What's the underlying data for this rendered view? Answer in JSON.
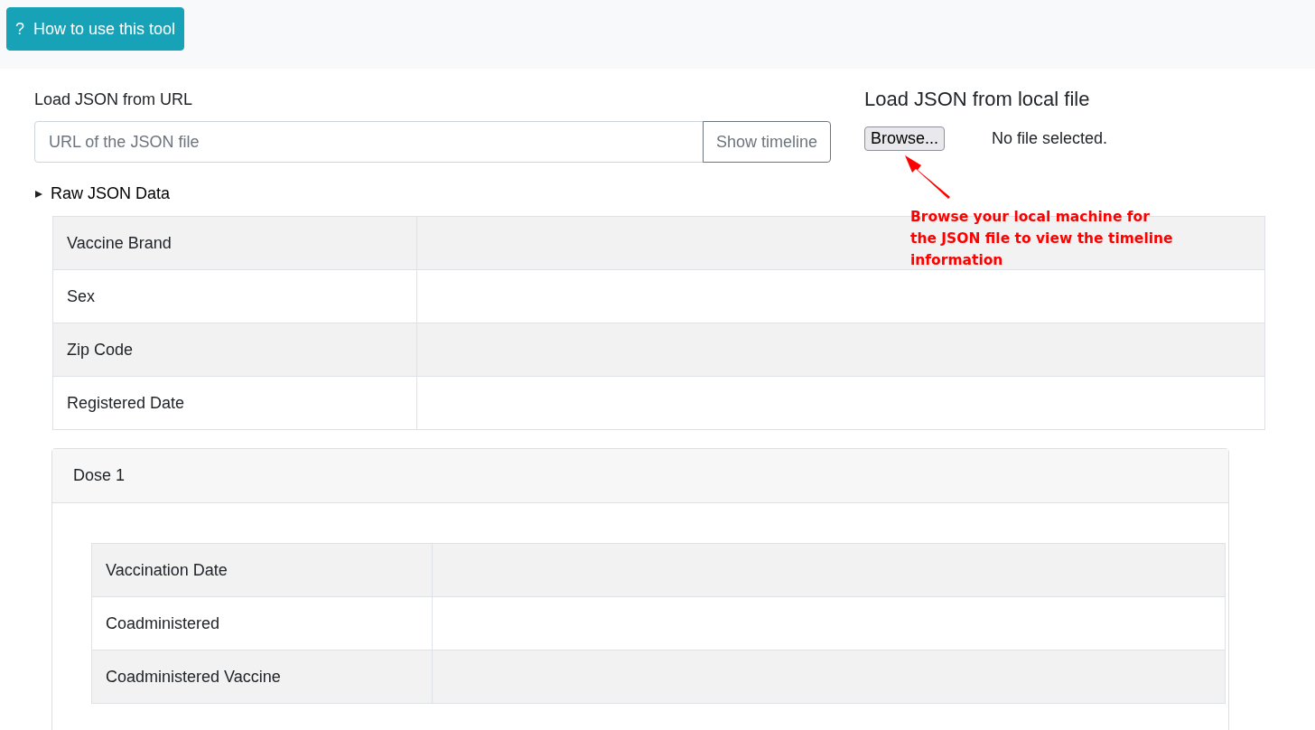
{
  "help_button": {
    "icon": "?",
    "label": "How to use this tool"
  },
  "url_loader": {
    "label": "Load JSON from URL",
    "placeholder": "URL of the JSON file",
    "button": "Show timeline"
  },
  "file_loader": {
    "title": "Load JSON from local file",
    "button": "Browse...",
    "status": "No file selected."
  },
  "annotation": {
    "text": "Browse your local machine for\nthe JSON file to view the timeline\ninformation"
  },
  "raw_json": {
    "label": "Raw JSON Data",
    "expanded": false
  },
  "summary_rows": [
    {
      "label": "Vaccine Brand"
    },
    {
      "label": "Sex"
    },
    {
      "label": "Zip Code"
    },
    {
      "label": "Registered Date"
    }
  ],
  "doses": [
    {
      "title": "Dose 1",
      "rows": [
        {
          "label": "Vaccination Date"
        },
        {
          "label": "Coadministered"
        },
        {
          "label": "Coadministered Vaccine"
        }
      ]
    }
  ]
}
